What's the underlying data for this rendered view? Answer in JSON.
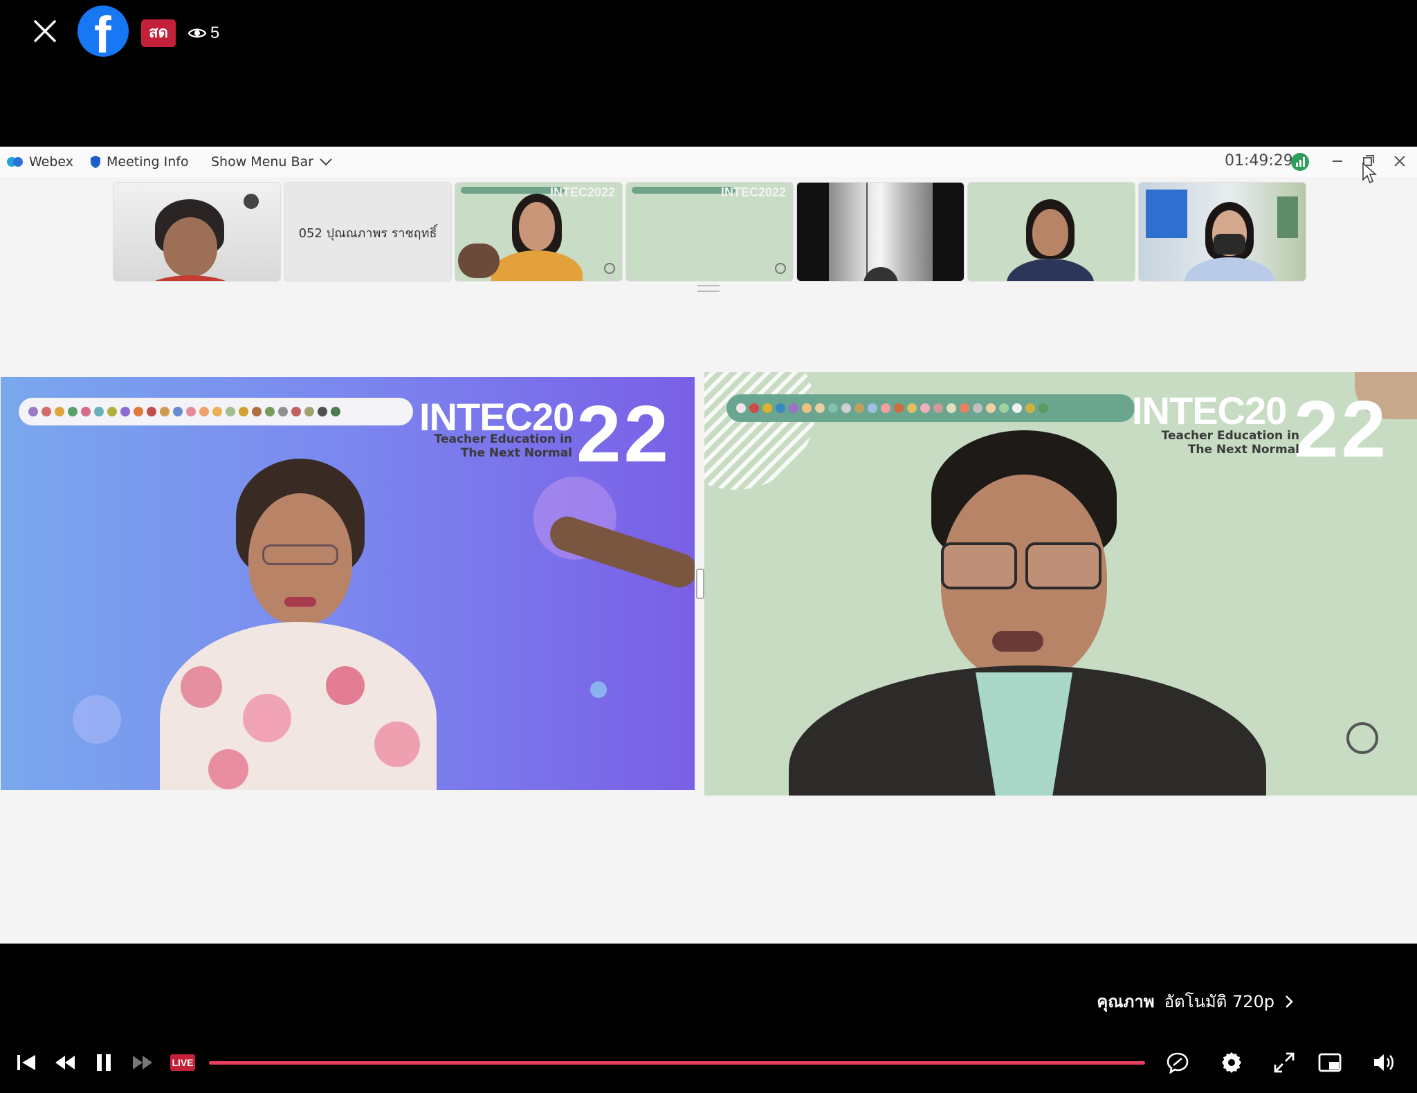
{
  "overlay": {
    "live_label": "สด",
    "viewer_count": "5"
  },
  "webex": {
    "app_name": "Webex",
    "meeting_info": "Meeting Info",
    "show_menu_bar": "Show Menu Bar",
    "timer": "01:49:29",
    "participant_name": "052 ปุณณภาพร ราชฤทธิ์"
  },
  "slide": {
    "brand": "INTEC20",
    "year_suffix": "22",
    "subtitle_line1": "Teacher Education in",
    "subtitle_line2": "The Next Normal"
  },
  "player": {
    "quality_label": "คุณภาพ",
    "quality_value": "อัตโนมัติ 720p",
    "live_label": "LIVE",
    "progress_fraction": 1.0
  },
  "colors": {
    "facebook_blue": "#1877f2",
    "live_red": "#c3203a",
    "progress_red": "#e63e5c"
  }
}
